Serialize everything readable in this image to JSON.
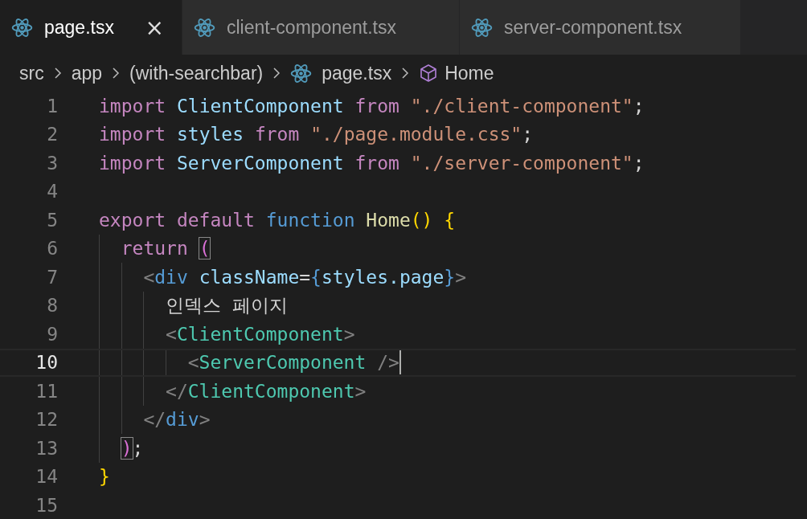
{
  "tabs": [
    {
      "label": "page.tsx",
      "selected": true,
      "close": "×"
    },
    {
      "label": "client-component.tsx",
      "selected": false
    },
    {
      "label": "server-component.tsx",
      "selected": false
    }
  ],
  "breadcrumb": [
    {
      "kind": "folder",
      "text": "src"
    },
    {
      "kind": "folder",
      "text": "app"
    },
    {
      "kind": "folder",
      "text": "(with-searchbar)"
    },
    {
      "kind": "file",
      "text": "page.tsx"
    },
    {
      "kind": "symbol",
      "text": "Home"
    }
  ],
  "lines": [
    {
      "number": "1",
      "current": false,
      "tokens": [
        {
          "kind": "keyword",
          "text": "import "
        },
        {
          "kind": "variable",
          "text": "ClientComponent "
        },
        {
          "kind": "keyword",
          "text": "from "
        },
        {
          "kind": "string",
          "text": "\"./client-component\""
        },
        {
          "kind": "plain",
          "text": ";"
        }
      ]
    },
    {
      "number": "2",
      "current": false,
      "tokens": [
        {
          "kind": "keyword",
          "text": "import "
        },
        {
          "kind": "variable",
          "text": "styles "
        },
        {
          "kind": "keyword",
          "text": "from "
        },
        {
          "kind": "string",
          "text": "\"./page.module.css\""
        },
        {
          "kind": "plain",
          "text": ";"
        }
      ]
    },
    {
      "number": "3",
      "current": false,
      "tokens": [
        {
          "kind": "keyword",
          "text": "import "
        },
        {
          "kind": "variable",
          "text": "ServerComponent "
        },
        {
          "kind": "keyword",
          "text": "from "
        },
        {
          "kind": "string",
          "text": "\"./server-component\""
        },
        {
          "kind": "plain",
          "text": ";"
        }
      ]
    },
    {
      "number": "4",
      "current": false
    },
    {
      "number": "5",
      "current": false,
      "tokens": [
        {
          "kind": "keyword",
          "text": "export default "
        },
        {
          "kind": "storage",
          "text": "function "
        },
        {
          "kind": "function",
          "text": "Home"
        },
        {
          "kind": "brace",
          "text": "() {"
        }
      ]
    },
    {
      "number": "6",
      "current": false,
      "tokens": [
        {
          "kind": "guide"
        },
        {
          "kind": "keyword",
          "text": "return "
        },
        {
          "kind": "match",
          "text": "("
        }
      ]
    },
    {
      "number": "7",
      "current": false,
      "tokens": [
        {
          "kind": "guide"
        },
        {
          "kind": "guide"
        },
        {
          "kind": "punct",
          "text": "<"
        },
        {
          "kind": "storage",
          "text": "div "
        },
        {
          "kind": "variable",
          "text": "className"
        },
        {
          "kind": "plain",
          "text": "="
        },
        {
          "kind": "blue-brace",
          "text": "{"
        },
        {
          "kind": "variable",
          "text": "styles.page"
        },
        {
          "kind": "blue-brace",
          "text": "}"
        },
        {
          "kind": "punct",
          "text": ">"
        }
      ]
    },
    {
      "number": "8",
      "current": false,
      "tokens": [
        {
          "kind": "guide"
        },
        {
          "kind": "guide"
        },
        {
          "kind": "guide"
        },
        {
          "kind": "plain",
          "text": "인덱스 페이지"
        }
      ]
    },
    {
      "number": "9",
      "current": false,
      "tokens": [
        {
          "kind": "guide"
        },
        {
          "kind": "guide"
        },
        {
          "kind": "guide"
        },
        {
          "kind": "punct",
          "text": "<"
        },
        {
          "kind": "tag",
          "text": "ClientComponent"
        },
        {
          "kind": "punct",
          "text": ">"
        }
      ]
    },
    {
      "number": "10",
      "current": true,
      "tokens": [
        {
          "kind": "guide"
        },
        {
          "kind": "guide"
        },
        {
          "kind": "guide"
        },
        {
          "kind": "guide"
        },
        {
          "kind": "punct",
          "text": "<"
        },
        {
          "kind": "tag",
          "text": "ServerComponent "
        },
        {
          "kind": "punct",
          "text": "/>"
        }
      ]
    },
    {
      "number": "11",
      "current": false,
      "tokens": [
        {
          "kind": "guide"
        },
        {
          "kind": "guide"
        },
        {
          "kind": "guide"
        },
        {
          "kind": "punct",
          "text": "</"
        },
        {
          "kind": "tag",
          "text": "ClientComponent"
        },
        {
          "kind": "punct",
          "text": ">"
        }
      ]
    },
    {
      "number": "12",
      "current": false,
      "tokens": [
        {
          "kind": "guide"
        },
        {
          "kind": "guide"
        },
        {
          "kind": "punct",
          "text": "</"
        },
        {
          "kind": "storage",
          "text": "div"
        },
        {
          "kind": "punct",
          "text": ">"
        }
      ]
    },
    {
      "number": "13",
      "current": false,
      "tokens": [
        {
          "kind": "guide"
        },
        {
          "kind": "match",
          "text": ")"
        },
        {
          "kind": "plain",
          "text": ";"
        }
      ]
    },
    {
      "number": "14",
      "current": false,
      "tokens": [
        {
          "kind": "brace",
          "text": "}"
        }
      ]
    },
    {
      "number": "15",
      "current": false
    }
  ]
}
